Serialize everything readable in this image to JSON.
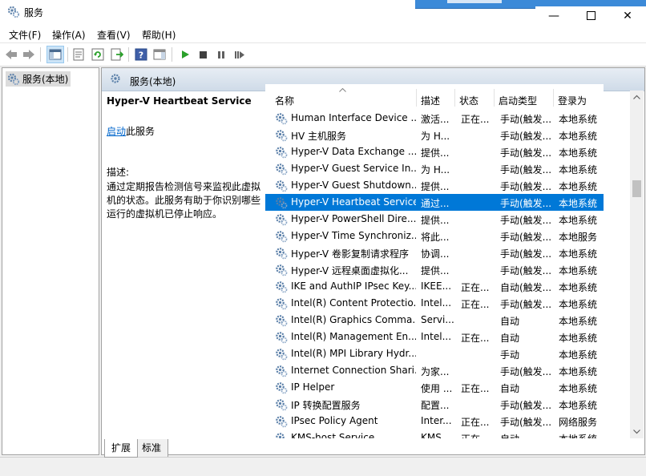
{
  "window": {
    "title": "服务"
  },
  "menu": {
    "items": [
      "文件(F)",
      "操作(A)",
      "查看(V)",
      "帮助(H)"
    ]
  },
  "tree": {
    "root_label": "服务(本地)"
  },
  "main": {
    "header_title": "服务(本地)"
  },
  "detail": {
    "service_title": "Hyper-V Heartbeat Service",
    "start_link": "启动",
    "start_suffix": "此服务",
    "description_label": "描述:",
    "description": "通过定期报告检测信号来监视此虚拟机的状态。此服务有助于你识别哪些运行的虚拟机已停止响应。"
  },
  "columns": {
    "name": "名称",
    "desc": "描述",
    "state": "状态",
    "start": "启动类型",
    "logon": "登录为"
  },
  "services": [
    {
      "name": "Human Interface Device ...",
      "desc": "激活...",
      "state": "正在...",
      "start": "手动(触发...",
      "logon": "本地系统"
    },
    {
      "name": "HV 主机服务",
      "desc": "为 H...",
      "state": "",
      "start": "手动(触发...",
      "logon": "本地系统"
    },
    {
      "name": "Hyper-V Data Exchange ...",
      "desc": "提供...",
      "state": "",
      "start": "手动(触发...",
      "logon": "本地系统"
    },
    {
      "name": "Hyper-V Guest Service In...",
      "desc": "为 H...",
      "state": "",
      "start": "手动(触发...",
      "logon": "本地系统"
    },
    {
      "name": "Hyper-V Guest Shutdown...",
      "desc": "提供...",
      "state": "",
      "start": "手动(触发...",
      "logon": "本地系统"
    },
    {
      "name": "Hyper-V Heartbeat Service",
      "desc": "通过...",
      "state": "",
      "start": "手动(触发...",
      "logon": "本地系统"
    },
    {
      "name": "Hyper-V PowerShell Dire...",
      "desc": "提供...",
      "state": "",
      "start": "手动(触发...",
      "logon": "本地系统"
    },
    {
      "name": "Hyper-V Time Synchroniz...",
      "desc": "将此...",
      "state": "",
      "start": "手动(触发...",
      "logon": "本地服务"
    },
    {
      "name": "Hyper-V 卷影复制请求程序",
      "desc": "协调...",
      "state": "",
      "start": "手动(触发...",
      "logon": "本地系统"
    },
    {
      "name": "Hyper-V 远程桌面虚拟化...",
      "desc": "提供...",
      "state": "",
      "start": "手动(触发...",
      "logon": "本地系统"
    },
    {
      "name": "IKE and AuthIP IPsec Key...",
      "desc": "IKEE...",
      "state": "正在...",
      "start": "自动(触发...",
      "logon": "本地系统"
    },
    {
      "name": "Intel(R) Content Protectio...",
      "desc": "Intel...",
      "state": "正在...",
      "start": "手动(触发...",
      "logon": "本地系统"
    },
    {
      "name": "Intel(R) Graphics Comma...",
      "desc": "Servi...",
      "state": "",
      "start": "自动",
      "logon": "本地系统"
    },
    {
      "name": "Intel(R) Management En...",
      "desc": "Intel...",
      "state": "正在...",
      "start": "自动",
      "logon": "本地系统"
    },
    {
      "name": "Intel(R) MPI Library Hydr...",
      "desc": "",
      "state": "",
      "start": "手动",
      "logon": "本地系统"
    },
    {
      "name": "Internet Connection Shari...",
      "desc": "为家...",
      "state": "",
      "start": "手动(触发...",
      "logon": "本地系统"
    },
    {
      "name": "IP Helper",
      "desc": "使用 ...",
      "state": "正在...",
      "start": "自动",
      "logon": "本地系统"
    },
    {
      "name": "IP 转换配置服务",
      "desc": "配置...",
      "state": "",
      "start": "手动(触发...",
      "logon": "本地系统"
    },
    {
      "name": "IPsec Policy Agent",
      "desc": "Inter...",
      "state": "正在...",
      "start": "手动(触发...",
      "logon": "网络服务"
    },
    {
      "name": "KMS-host Service",
      "desc": "KMS...",
      "state": "正在...",
      "start": "自动",
      "logon": "本地系统"
    }
  ],
  "selected_index": 5,
  "tabs": [
    "扩展",
    "标准"
  ],
  "colors": {
    "selection": "#0078d7",
    "link": "#0066cc",
    "gear": "#5a7fa8",
    "play": "#2aa02a"
  }
}
